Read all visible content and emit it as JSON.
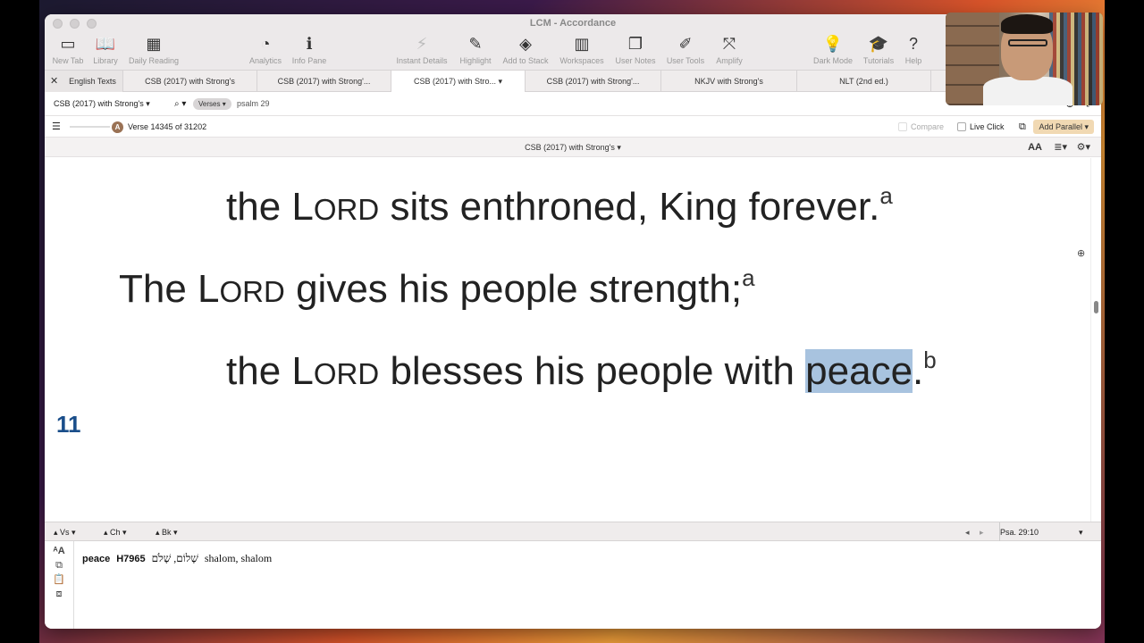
{
  "window": {
    "title": "LCM - Accordance"
  },
  "toolbar": {
    "items": [
      {
        "label": "New Tab",
        "icon": "new-tab-icon",
        "glyph": "▭"
      },
      {
        "label": "Library",
        "icon": "book-icon",
        "glyph": "📖"
      },
      {
        "label": "Daily Reading",
        "icon": "calendar-icon",
        "glyph": "▦"
      },
      {
        "label": "Analytics",
        "icon": "pie-chart-icon",
        "glyph": "◔"
      },
      {
        "label": "Info Pane",
        "icon": "info-icon",
        "glyph": "ℹ"
      },
      {
        "label": "Instant Details",
        "icon": "instant-details-icon",
        "glyph": "⚡"
      },
      {
        "label": "Highlight",
        "icon": "pencil-icon",
        "glyph": "✎"
      },
      {
        "label": "Add to Stack",
        "icon": "layers-icon",
        "glyph": "◈"
      },
      {
        "label": "Workspaces",
        "icon": "workspaces-icon",
        "glyph": "▥"
      },
      {
        "label": "User Notes",
        "icon": "notes-icon",
        "glyph": "❐"
      },
      {
        "label": "User Tools",
        "icon": "edit-icon",
        "glyph": "✐"
      },
      {
        "label": "Amplify",
        "icon": "amplify-icon",
        "glyph": "⤧"
      },
      {
        "label": "Dark Mode",
        "icon": "lightbulb-icon",
        "glyph": "💡"
      },
      {
        "label": "Tutorials",
        "icon": "graduation-cap-icon",
        "glyph": "🎓"
      },
      {
        "label": "Help",
        "icon": "help-icon",
        "glyph": "?"
      }
    ]
  },
  "tabs": {
    "group_label": "English Texts",
    "items": [
      "CSB (2017) with Strong's",
      "CSB (2017) with Strong'...",
      "CSB (2017) with Stro...",
      "CSB (2017) with Strong'...",
      "NKJV with Strong's",
      "NLT (2nd ed.)"
    ]
  },
  "search": {
    "module": "CSB (2017) with Strong's",
    "mode": "Verses",
    "query": "psalm 29"
  },
  "info": {
    "badge": "A",
    "verse_status": "Verse 14345 of 31202",
    "compare": "Compare",
    "live_click": "Live Click",
    "add_parallel": "Add Parallel"
  },
  "pane": {
    "title": "CSB (2017) with Strong's",
    "font_icon": "AA"
  },
  "text": {
    "line1_pre": "the L",
    "line1_sc": "ORD",
    "line1_post": " sits enthroned, King forever.",
    "line1_note": "a",
    "verse_number": "11",
    "line2_pre": "The L",
    "line2_sc": "ORD",
    "line2_post": " gives his people strength;",
    "line2_note": "a",
    "line3_pre": "the L",
    "line3_sc": "ORD",
    "line3_post": " blesses his people with ",
    "line3_highlight": "peace",
    "line3_end": ".",
    "line3_note": "b"
  },
  "nav": {
    "verse": "Vs",
    "chapter": "Ch",
    "book": "Bk",
    "reference": "Psa. 29:10"
  },
  "instant_details": {
    "word": "peace",
    "strongs": "H7965",
    "hebrew": "שָׁלוֹם, שָׁלֹם",
    "translit": "shalom, shalom"
  }
}
